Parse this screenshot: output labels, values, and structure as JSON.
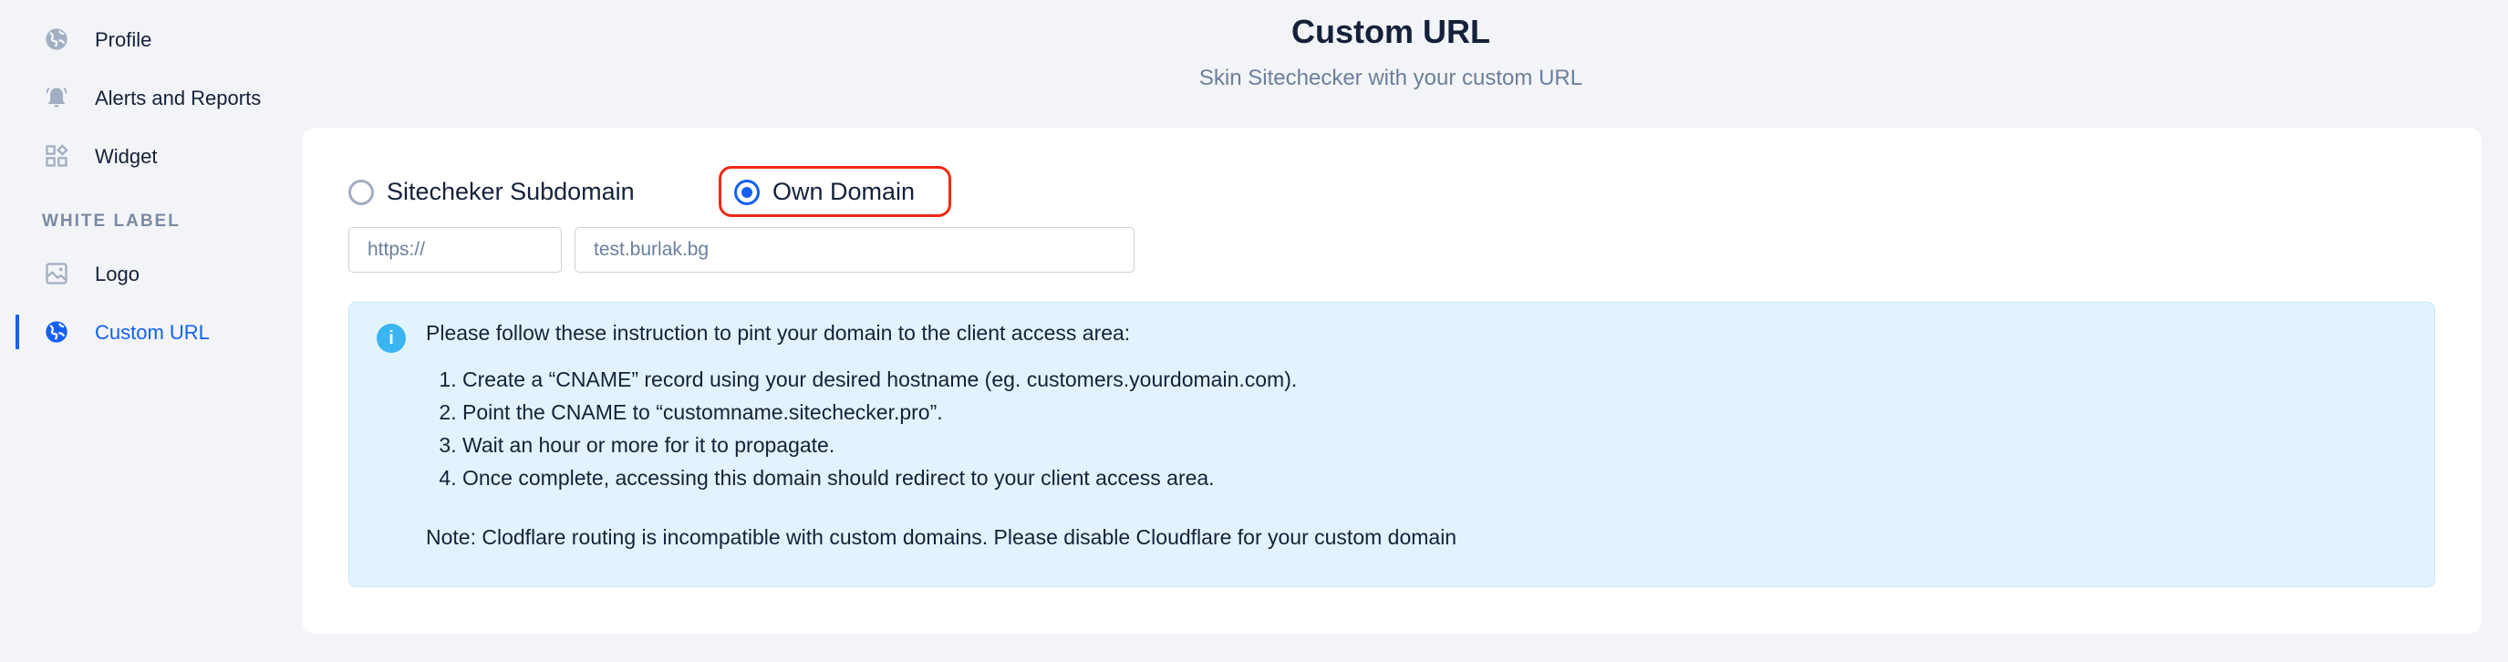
{
  "sidebar": {
    "items": [
      {
        "label": "Profile",
        "icon": "globe-icon",
        "active": false
      },
      {
        "label": "Alerts and Reports",
        "icon": "bell-icon",
        "active": false
      },
      {
        "label": "Widget",
        "icon": "widget-icon",
        "active": false
      }
    ],
    "section_label": "WHITE LABEL",
    "white_label_items": [
      {
        "label": "Logo",
        "icon": "image-icon",
        "active": false
      },
      {
        "label": "Custom URL",
        "icon": "globe-icon",
        "active": true
      }
    ]
  },
  "header": {
    "title": "Custom URL",
    "subtitle": "Skin Sitechecker with your custom URL"
  },
  "form": {
    "options": [
      {
        "label": "Sitecheker Subdomain",
        "checked": false
      },
      {
        "label": "Own Domain",
        "checked": true
      }
    ],
    "protocol_value": "https://",
    "domain_value": "test.burlak.bg"
  },
  "info": {
    "icon": "info-icon",
    "heading": "Please follow these instruction to pint your domain to the client access area:",
    "steps": [
      "Create a “CNAME” record using your desired hostname (eg. customers.yourdomain.com).",
      "Point the CNAME to “customname.sitechecker.pro”.",
      "Wait an hour or more for it to propagate.",
      "Once complete, accessing this domain should redirect to your client access area."
    ],
    "note": "Note: Clodflare routing is incompatible with custom domains. Please disable Cloudflare for your custom domain"
  },
  "colors": {
    "accent": "#1560f2",
    "highlight": "#ee2a16",
    "info_bg": "#e1f4fd",
    "info_icon": "#3bb4f2"
  }
}
